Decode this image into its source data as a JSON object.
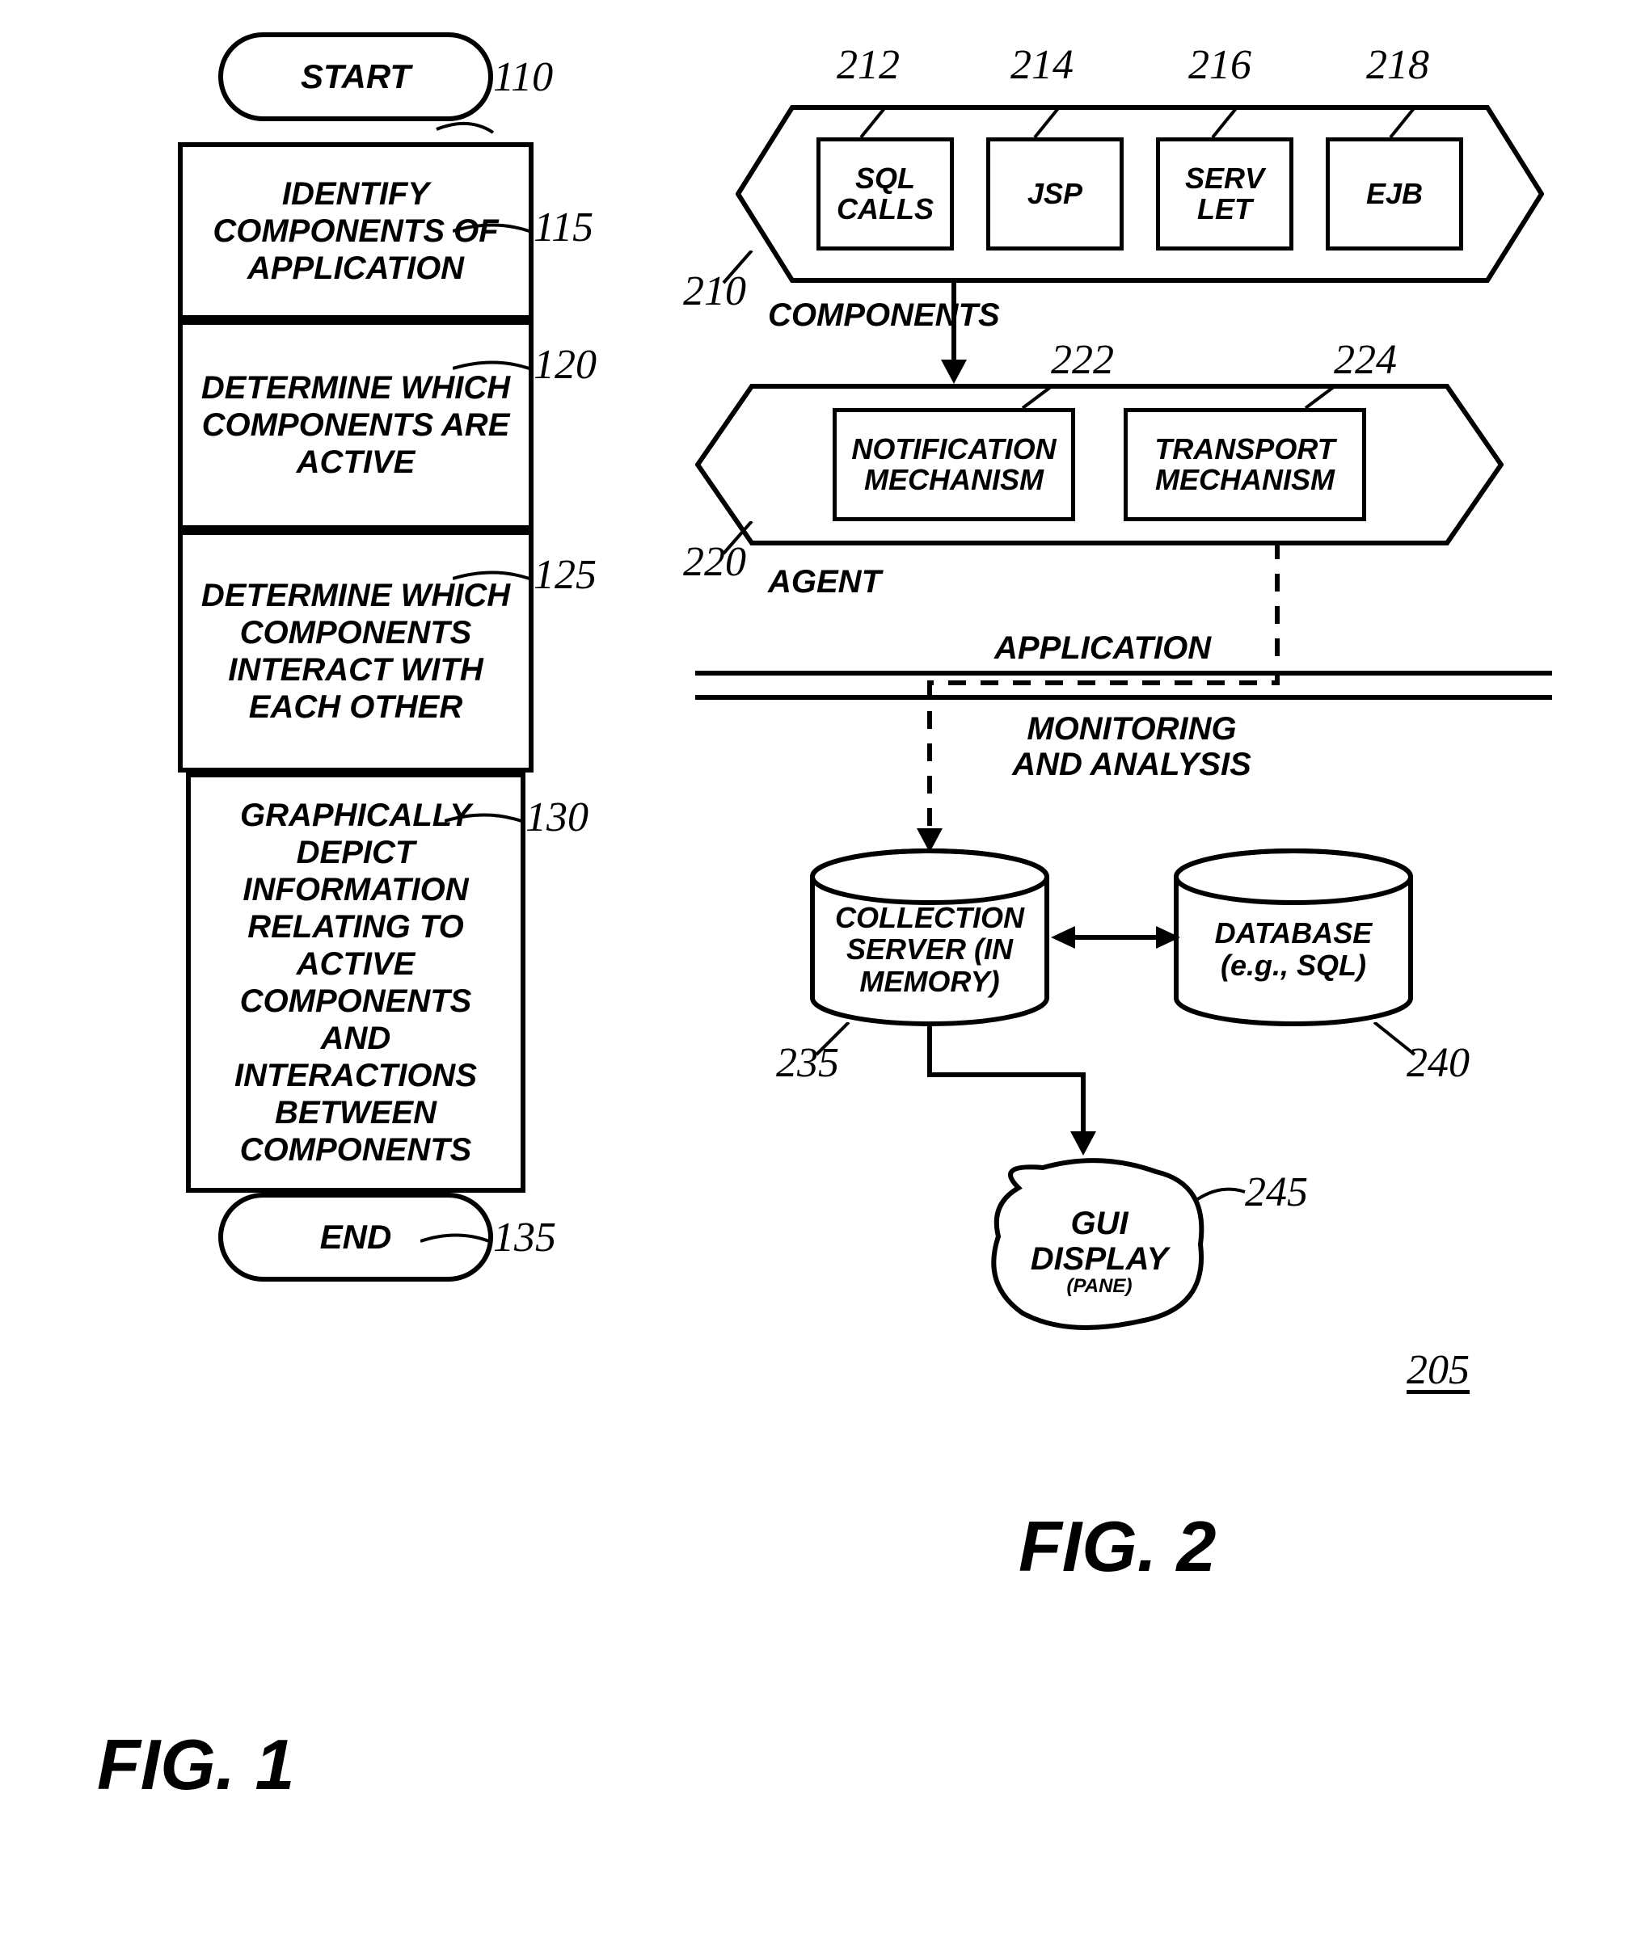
{
  "fig1": {
    "title": "FIG. 1",
    "start": "START",
    "end": "END",
    "steps": [
      {
        "text": "IDENTIFY COMPONENTS OF APPLICATION",
        "ref": "115"
      },
      {
        "text": "DETERMINE WHICH COMPONENTS ARE ACTIVE",
        "ref": "120"
      },
      {
        "text": "DETERMINE WHICH COMPONENTS INTERACT WITH EACH OTHER",
        "ref": "125"
      },
      {
        "text": "GRAPHICALLY DEPICT INFORMATION RELATING TO ACTIVE COMPONENTS AND INTERACTIONS BETWEEN COMPONENTS",
        "ref": "130"
      }
    ],
    "refs": {
      "start": "110",
      "end": "135"
    }
  },
  "fig2": {
    "title": "FIG. 2",
    "overall_ref": "205",
    "components_band": {
      "label": "COMPONENTS",
      "ref": "210",
      "items": [
        {
          "label": "SQL CALLS",
          "ref": "212"
        },
        {
          "label": "JSP",
          "ref": "214"
        },
        {
          "label": "SERV LET",
          "ref": "216"
        },
        {
          "label": "EJB",
          "ref": "218"
        }
      ]
    },
    "agent_band": {
      "label": "AGENT",
      "ref": "220",
      "items": [
        {
          "label": "NOTIFICATION MECHANISM",
          "ref": "222"
        },
        {
          "label": "TRANSPORT MECHANISM",
          "ref": "224"
        }
      ]
    },
    "section_labels": {
      "application": "APPLICATION",
      "monitoring": "MONITORING AND ANALYSIS"
    },
    "collection_server": {
      "label": "COLLECTION SERVER (IN MEMORY)",
      "ref": "235"
    },
    "database": {
      "label": "DATABASE (e.g., SQL)",
      "ref": "240"
    },
    "gui": {
      "label": "GUI DISPLAY",
      "sub": "(PANE)",
      "ref": "245"
    }
  }
}
